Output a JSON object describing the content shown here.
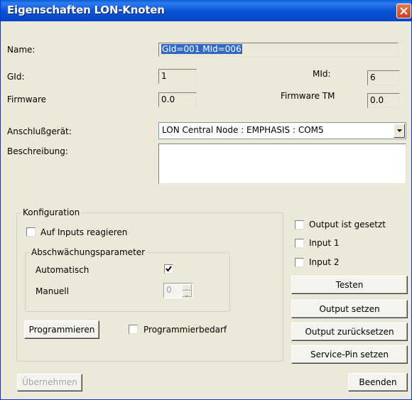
{
  "window": {
    "title": "Eigenschaften LON-Knoten"
  },
  "fields": {
    "name_label": "Name:",
    "name_value": "GId=001 MId=006",
    "gid_label": "GId:",
    "gid_value": "1",
    "mid_label": "MId:",
    "mid_value": "6",
    "firmware_label": "Firmware",
    "firmware_value": "0.0",
    "firmware_tm_label": "Firmware TM",
    "firmware_tm_value": "0.0",
    "anschluss_label": "Anschlußgerät:",
    "anschluss_value": "LON Central Node : EMPHASIS : COM5",
    "beschreibung_label": "Beschreibung:",
    "beschreibung_value": ""
  },
  "konfiguration": {
    "title": "Konfiguration",
    "auf_inputs_label": "Auf Inputs reagieren",
    "auf_inputs_checked": false,
    "abschwaechung": {
      "title": "Abschwächungsparameter",
      "automatisch_label": "Automatisch",
      "automatisch_checked": true,
      "manuell_label": "Manuell",
      "manuell_value": "0"
    },
    "programmieren_button": "Programmieren",
    "programmierbedarf_label": "Programmierbedarf",
    "programmierbedarf_checked": false
  },
  "right_panel": {
    "output_gesetzt_label": "Output ist gesetzt",
    "input1_label": "Input 1",
    "input2_label": "Input 2",
    "testen_button": "Testen",
    "output_setzen_button": "Output setzen",
    "output_zuruecksetzen_button": "Output zurücksetzen",
    "service_pin_button": "Service-Pin setzen"
  },
  "footer": {
    "uebernehmen_button": "Übernehmen",
    "beenden_button": "Beenden"
  }
}
